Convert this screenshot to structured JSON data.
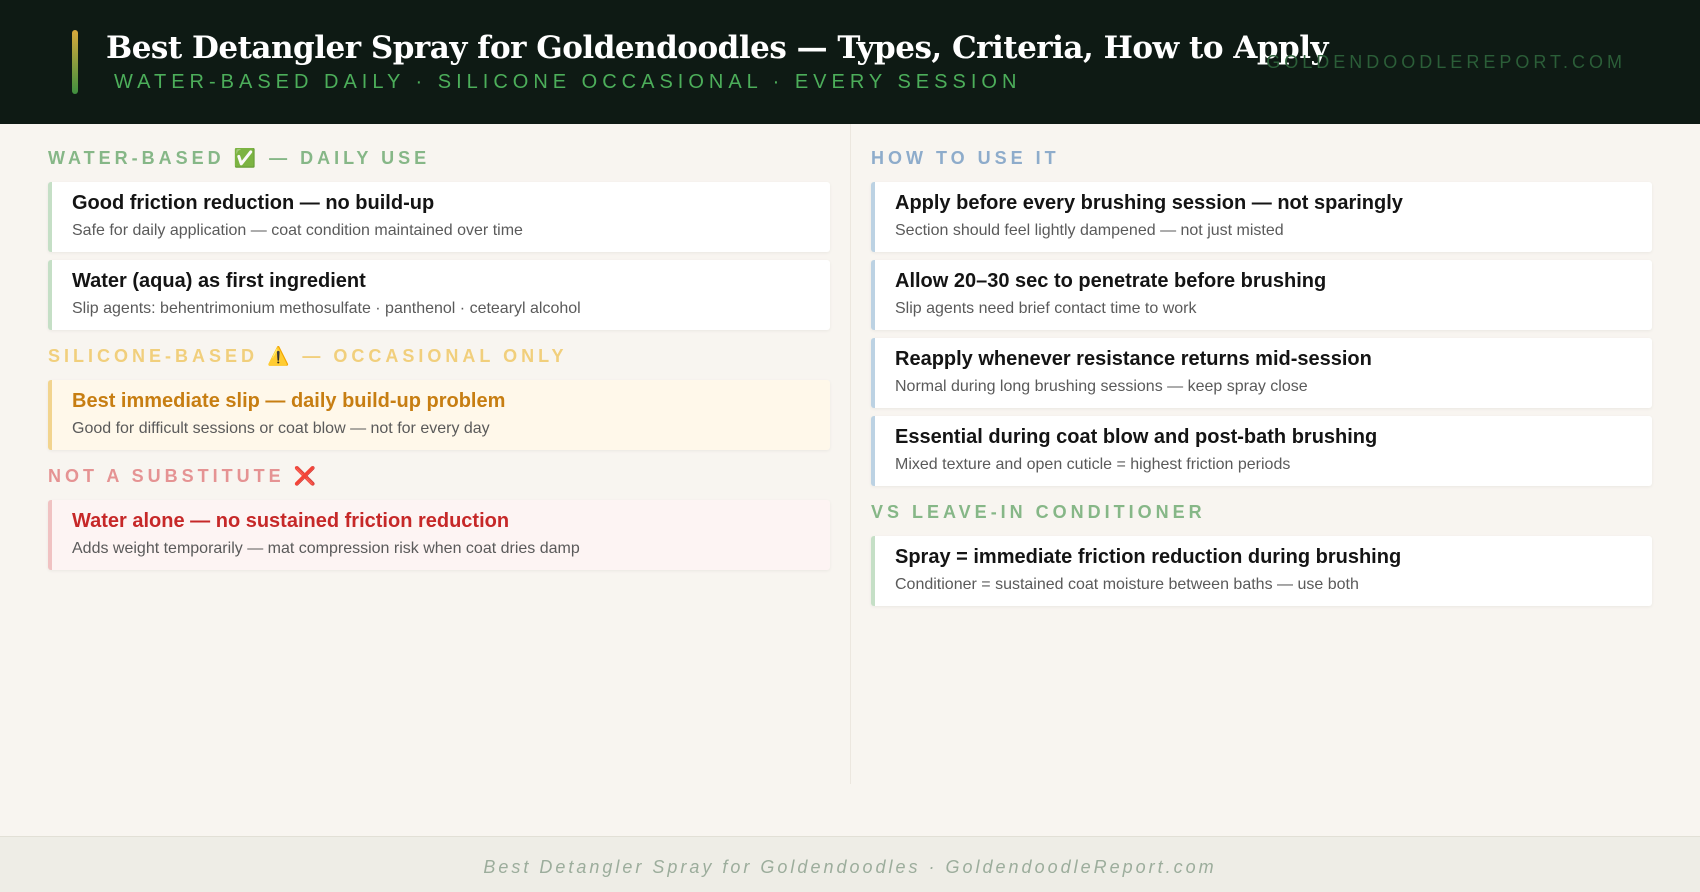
{
  "header": {
    "title": "Best Detangler Spray for Goldendoodles — Types, Criteria, How to Apply",
    "subtitle": "WATER-BASED DAILY · SILICONE OCCASIONAL · EVERY SESSION",
    "site": "GOLDENDOODLEREPORT.COM"
  },
  "left": {
    "water": {
      "label": "WATER-BASED ✅ — DAILY USE",
      "cards": [
        {
          "title": "Good friction reduction — no build-up",
          "sub": "Safe for daily application — coat condition maintained over time"
        },
        {
          "title": "Water (aqua) as first ingredient",
          "sub": "Slip agents: behentrimonium methosulfate · panthenol · cetearyl alcohol"
        }
      ]
    },
    "silicone": {
      "label": "SILICONE-BASED ⚠️ — OCCASIONAL ONLY",
      "cards": [
        {
          "title": "Best immediate slip — daily build-up problem",
          "sub": "Good for difficult sessions or coat blow — not for every day"
        }
      ]
    },
    "substitute": {
      "label": "NOT A SUBSTITUTE ❌",
      "cards": [
        {
          "title": "Water alone — no sustained friction reduction",
          "sub": "Adds weight temporarily — mat compression risk when coat dries damp"
        }
      ]
    }
  },
  "right": {
    "howto": {
      "label": "HOW TO USE IT",
      "cards": [
        {
          "title": "Apply before every brushing session — not sparingly",
          "sub": "Section should feel lightly dampened — not just misted"
        },
        {
          "title": "Allow 20–30 sec to penetrate before brushing",
          "sub": "Slip agents need brief contact time to work"
        },
        {
          "title": "Reapply whenever resistance returns mid-session",
          "sub": "Normal during long brushing sessions — keep spray close"
        },
        {
          "title": "Essential during coat blow and post-bath brushing",
          "sub": "Mixed texture and open cuticle = highest friction periods"
        }
      ]
    },
    "vs": {
      "label": "VS LEAVE-IN CONDITIONER",
      "cards": [
        {
          "title": "Spray = immediate friction reduction during brushing",
          "sub": "Conditioner = sustained coat moisture between baths — use both"
        }
      ]
    }
  },
  "footer": {
    "text": "Best Detangler Spray for Goldendoodles · GoldendoodleReport.com"
  },
  "colors": {
    "header_bg": "#0e1a14",
    "green_label": "#86b787",
    "yellow_label": "#f1cf7c",
    "red_label": "#e59393",
    "blue_label": "#8eaccb"
  }
}
